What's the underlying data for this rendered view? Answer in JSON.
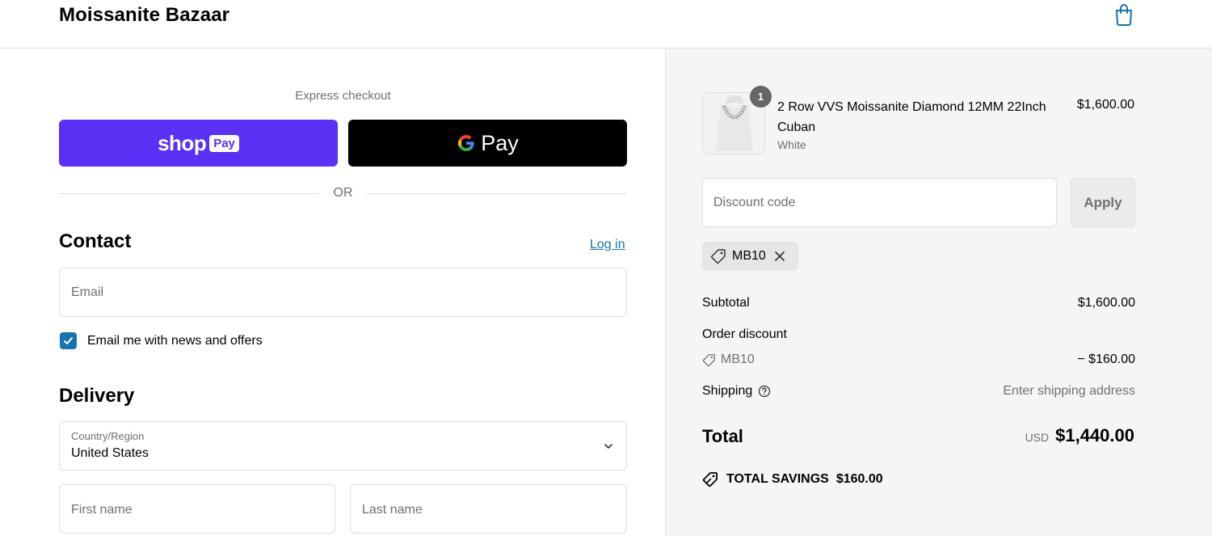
{
  "header": {
    "brand": "Moissanite Bazaar"
  },
  "express": {
    "label": "Express checkout",
    "shop_pay_word": "shop",
    "shop_pay_box": "Pay",
    "gpay_word": "Pay",
    "or_text": "OR"
  },
  "contact": {
    "title": "Contact",
    "login_link": "Log in",
    "email_placeholder": "Email",
    "newsletter_label": "Email me with news and offers",
    "newsletter_checked": true
  },
  "delivery": {
    "title": "Delivery",
    "country_label": "Country/Region",
    "country_value": "United States",
    "first_name_placeholder": "First name",
    "last_name_placeholder": "Last name"
  },
  "order": {
    "item": {
      "quantity": "1",
      "name": "2 Row VVS Moissanite Diamond 12MM 22Inch Cuban",
      "variant": "White",
      "price": "$1,600.00"
    },
    "discount_placeholder": "Discount code",
    "apply_label": "Apply",
    "applied_code": "MB10",
    "subtotal_label": "Subtotal",
    "subtotal_value": "$1,600.00",
    "order_discount_label": "Order discount",
    "discount_code": "MB10",
    "discount_value": "− $160.00",
    "shipping_label": "Shipping",
    "shipping_value": "Enter shipping address",
    "total_label": "Total",
    "total_currency": "USD",
    "total_value": "$1,440.00",
    "savings_label": "TOTAL SAVINGS",
    "savings_value": "$160.00"
  },
  "colors": {
    "shop_pay": "#5a31f4",
    "link": "#1773b0",
    "checkbox": "#1773b0"
  }
}
